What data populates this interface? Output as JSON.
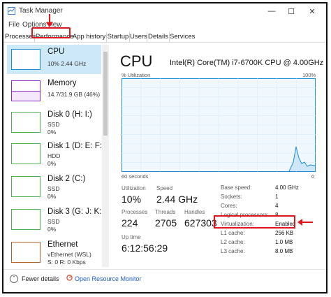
{
  "window": {
    "title": "Task Manager",
    "minimize": "—",
    "maximize": "☐",
    "close": "✕"
  },
  "menu": [
    "File",
    "Options",
    "View"
  ],
  "tabs": [
    "Processes",
    "Performance",
    "App history",
    "Startup",
    "Users",
    "Details",
    "Services"
  ],
  "sidebar": [
    {
      "name": "CPU",
      "sub1": "10%  2.44 GHz",
      "sub2": "",
      "color": "#1a8fd6"
    },
    {
      "name": "Memory",
      "sub1": "14.7/31.9 GB (46%)",
      "sub2": "",
      "color": "#8b2fc9"
    },
    {
      "name": "Disk 0 (H: I:)",
      "sub1": "SSD",
      "sub2": "0%",
      "color": "#4caf50"
    },
    {
      "name": "Disk 1 (D: E: F:)",
      "sub1": "HDD",
      "sub2": "0%",
      "color": "#4caf50"
    },
    {
      "name": "Disk 2 (C:)",
      "sub1": "SSD",
      "sub2": "0%",
      "color": "#4caf50"
    },
    {
      "name": "Disk 3 (G: J: K: M",
      "sub1": "SSD",
      "sub2": "0%",
      "color": "#4caf50"
    },
    {
      "name": "Ethernet",
      "sub1": "vEthernet (WSL)",
      "sub2": "S: 0  R: 0 Kbps",
      "color": "#b0612a"
    }
  ],
  "cpu": {
    "title": "CPU",
    "model": "Intel(R) Core(TM) i7-6700K CPU @ 4.00GHz",
    "graph_label_left": "% Utilization",
    "graph_label_right": "100%",
    "graph_foot_left": "60 seconds",
    "graph_foot_right": "0",
    "graph_color": "#1a8fd6"
  },
  "stats": {
    "utilization_label": "Utilization",
    "utilization": "10%",
    "speed_label": "Speed",
    "speed": "2.44 GHz",
    "processes_label": "Processes",
    "processes": "224",
    "threads_label": "Threads",
    "threads": "2705",
    "handles_label": "Handles",
    "handles": "627303",
    "uptime_label": "Up time",
    "uptime": "6:12:56:29"
  },
  "specs": [
    {
      "k": "Base speed:",
      "v": "4.00 GHz"
    },
    {
      "k": "Sockets:",
      "v": "1"
    },
    {
      "k": "Cores:",
      "v": "4"
    },
    {
      "k": "Logical processors:",
      "v": "8"
    },
    {
      "k": "Virtualization:",
      "v": "Enabled"
    },
    {
      "k": "L1 cache:",
      "v": "256 KB"
    },
    {
      "k": "L2 cache:",
      "v": "1.0 MB"
    },
    {
      "k": "L3 cache:",
      "v": "8.0 MB"
    }
  ],
  "footer": {
    "fewer_details": "Fewer details",
    "open_monitor": "Open Resource Monitor"
  },
  "annotation_color": "#e1131b"
}
